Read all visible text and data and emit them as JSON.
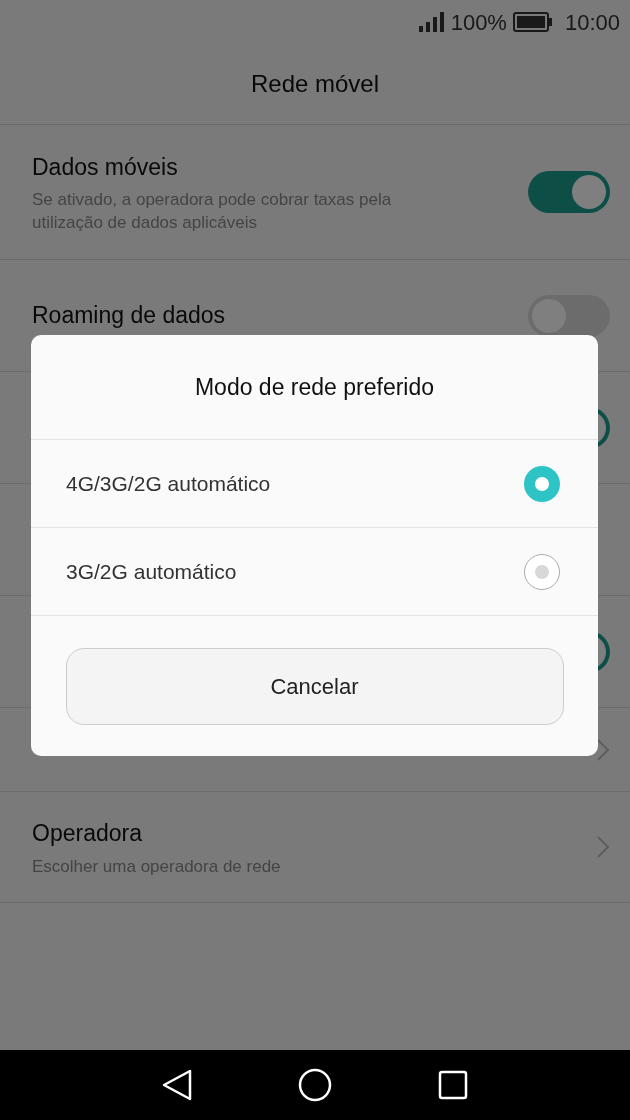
{
  "status_bar": {
    "battery": "100%",
    "time": "10:00"
  },
  "title": "Rede móvel",
  "settings": [
    {
      "kind": "switch",
      "title": "Dados móveis",
      "subtitle": "Se ativado, a operadora pode cobrar taxas pela utilização de dados aplicáveis",
      "on": true
    },
    {
      "kind": "switch",
      "title": "Roaming de dados",
      "on": false
    },
    {
      "kind": "switch",
      "on": true
    },
    {
      "kind": "blank"
    },
    {
      "kind": "switch",
      "on": true
    },
    {
      "kind": "link"
    },
    {
      "kind": "link",
      "title": "Operadora",
      "subtitle": "Escolher uma operadora de rede"
    }
  ],
  "dialog": {
    "title": "Modo de rede preferido",
    "options": [
      {
        "label": "4G/3G/2G automático",
        "selected": true
      },
      {
        "label": "3G/2G automático",
        "selected": false
      }
    ],
    "button": "Cancelar"
  }
}
